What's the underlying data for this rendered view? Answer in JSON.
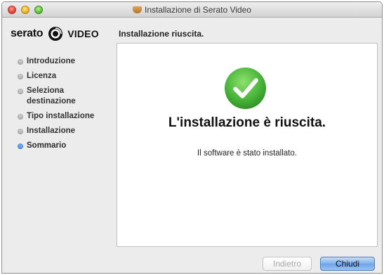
{
  "window": {
    "title": "Installazione di Serato Video"
  },
  "brand": {
    "name": "serato",
    "product": "VIDEO"
  },
  "header": {
    "status": "Installazione riuscita."
  },
  "sidebar": {
    "steps": [
      {
        "label": "Introduzione"
      },
      {
        "label": "Licenza"
      },
      {
        "label": "Seleziona destinazione"
      },
      {
        "label": "Tipo installazione"
      },
      {
        "label": "Installazione"
      },
      {
        "label": "Sommario",
        "active": true
      }
    ]
  },
  "main": {
    "icon": "checkmark-icon",
    "title": "L'installazione è riuscita.",
    "message": "Il software è stato installato."
  },
  "buttons": {
    "back_label": "Indietro",
    "close_label": "Chiudi"
  },
  "colors": {
    "success_green": "#49b63a",
    "accent_blue": "#2f6fd6"
  }
}
